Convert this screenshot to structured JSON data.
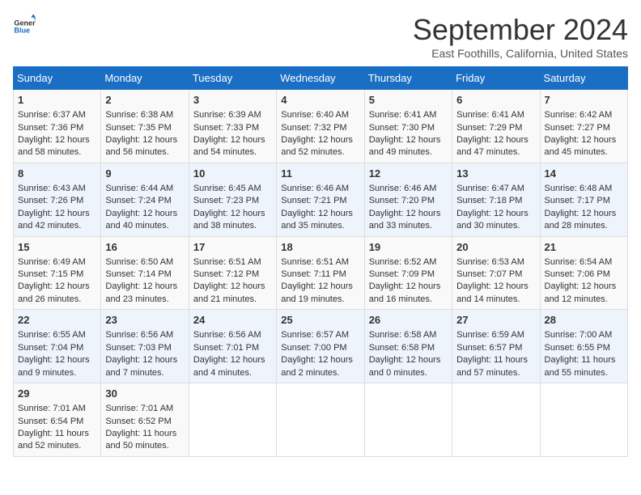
{
  "header": {
    "logo_line1": "General",
    "logo_line2": "Blue",
    "title": "September 2024",
    "location": "East Foothills, California, United States"
  },
  "columns": [
    "Sunday",
    "Monday",
    "Tuesday",
    "Wednesday",
    "Thursday",
    "Friday",
    "Saturday"
  ],
  "weeks": [
    [
      {
        "day": "1",
        "rise": "6:37 AM",
        "set": "7:36 PM",
        "daylight": "12 hours and 58 minutes."
      },
      {
        "day": "2",
        "rise": "6:38 AM",
        "set": "7:35 PM",
        "daylight": "12 hours and 56 minutes."
      },
      {
        "day": "3",
        "rise": "6:39 AM",
        "set": "7:33 PM",
        "daylight": "12 hours and 54 minutes."
      },
      {
        "day": "4",
        "rise": "6:40 AM",
        "set": "7:32 PM",
        "daylight": "12 hours and 52 minutes."
      },
      {
        "day": "5",
        "rise": "6:41 AM",
        "set": "7:30 PM",
        "daylight": "12 hours and 49 minutes."
      },
      {
        "day": "6",
        "rise": "6:41 AM",
        "set": "7:29 PM",
        "daylight": "12 hours and 47 minutes."
      },
      {
        "day": "7",
        "rise": "6:42 AM",
        "set": "7:27 PM",
        "daylight": "12 hours and 45 minutes."
      }
    ],
    [
      {
        "day": "8",
        "rise": "6:43 AM",
        "set": "7:26 PM",
        "daylight": "12 hours and 42 minutes."
      },
      {
        "day": "9",
        "rise": "6:44 AM",
        "set": "7:24 PM",
        "daylight": "12 hours and 40 minutes."
      },
      {
        "day": "10",
        "rise": "6:45 AM",
        "set": "7:23 PM",
        "daylight": "12 hours and 38 minutes."
      },
      {
        "day": "11",
        "rise": "6:46 AM",
        "set": "7:21 PM",
        "daylight": "12 hours and 35 minutes."
      },
      {
        "day": "12",
        "rise": "6:46 AM",
        "set": "7:20 PM",
        "daylight": "12 hours and 33 minutes."
      },
      {
        "day": "13",
        "rise": "6:47 AM",
        "set": "7:18 PM",
        "daylight": "12 hours and 30 minutes."
      },
      {
        "day": "14",
        "rise": "6:48 AM",
        "set": "7:17 PM",
        "daylight": "12 hours and 28 minutes."
      }
    ],
    [
      {
        "day": "15",
        "rise": "6:49 AM",
        "set": "7:15 PM",
        "daylight": "12 hours and 26 minutes."
      },
      {
        "day": "16",
        "rise": "6:50 AM",
        "set": "7:14 PM",
        "daylight": "12 hours and 23 minutes."
      },
      {
        "day": "17",
        "rise": "6:51 AM",
        "set": "7:12 PM",
        "daylight": "12 hours and 21 minutes."
      },
      {
        "day": "18",
        "rise": "6:51 AM",
        "set": "7:11 PM",
        "daylight": "12 hours and 19 minutes."
      },
      {
        "day": "19",
        "rise": "6:52 AM",
        "set": "7:09 PM",
        "daylight": "12 hours and 16 minutes."
      },
      {
        "day": "20",
        "rise": "6:53 AM",
        "set": "7:07 PM",
        "daylight": "12 hours and 14 minutes."
      },
      {
        "day": "21",
        "rise": "6:54 AM",
        "set": "7:06 PM",
        "daylight": "12 hours and 12 minutes."
      }
    ],
    [
      {
        "day": "22",
        "rise": "6:55 AM",
        "set": "7:04 PM",
        "daylight": "12 hours and 9 minutes."
      },
      {
        "day": "23",
        "rise": "6:56 AM",
        "set": "7:03 PM",
        "daylight": "12 hours and 7 minutes."
      },
      {
        "day": "24",
        "rise": "6:56 AM",
        "set": "7:01 PM",
        "daylight": "12 hours and 4 minutes."
      },
      {
        "day": "25",
        "rise": "6:57 AM",
        "set": "7:00 PM",
        "daylight": "12 hours and 2 minutes."
      },
      {
        "day": "26",
        "rise": "6:58 AM",
        "set": "6:58 PM",
        "daylight": "12 hours and 0 minutes."
      },
      {
        "day": "27",
        "rise": "6:59 AM",
        "set": "6:57 PM",
        "daylight": "11 hours and 57 minutes."
      },
      {
        "day": "28",
        "rise": "7:00 AM",
        "set": "6:55 PM",
        "daylight": "11 hours and 55 minutes."
      }
    ],
    [
      {
        "day": "29",
        "rise": "7:01 AM",
        "set": "6:54 PM",
        "daylight": "11 hours and 52 minutes."
      },
      {
        "day": "30",
        "rise": "7:01 AM",
        "set": "6:52 PM",
        "daylight": "11 hours and 50 minutes."
      },
      null,
      null,
      null,
      null,
      null
    ]
  ]
}
